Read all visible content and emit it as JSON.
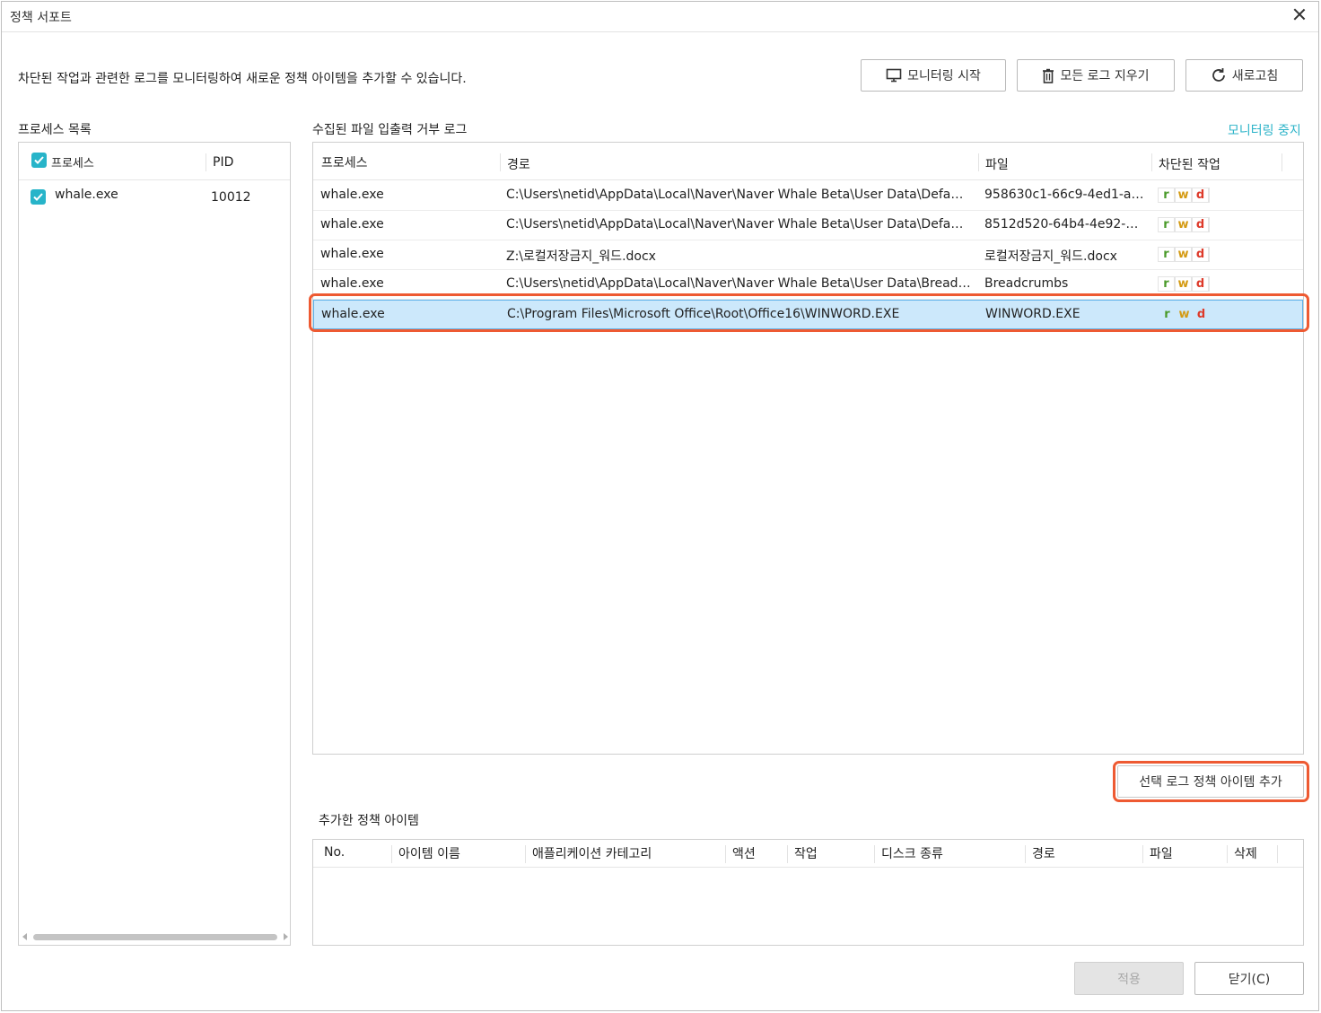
{
  "window": {
    "title": "정책 서포트"
  },
  "description": "차단된 작업과 관련한 로그를 모니터링하여 새로운 정책 아이템을 추가할 수 있습니다.",
  "toolbar": {
    "monitor_start": "모니터링 시작",
    "clear_logs": "모든 로그 지우기",
    "refresh": "새로고침"
  },
  "process_list": {
    "label": "프로세스 목록",
    "columns": {
      "process": "프로세스",
      "pid": "PID"
    },
    "rows": [
      {
        "name": "whale.exe",
        "pid": "10012"
      }
    ]
  },
  "log": {
    "label": "수집된 파일 입출력 거부 로그",
    "stop_link": "모니터링 중지",
    "columns": {
      "process": "프로세스",
      "path": "경로",
      "file": "파일",
      "blocked": "차단된 작업"
    },
    "rows": [
      {
        "process": "whale.exe",
        "path": "C:\\Users\\netid\\AppData\\Local\\Naver\\Naver Whale Beta\\User Data\\Default\\...",
        "file": "958630c1-66c9-4ed1-a3...",
        "ops": [
          "r",
          "w",
          "d"
        ]
      },
      {
        "process": "whale.exe",
        "path": "C:\\Users\\netid\\AppData\\Local\\Naver\\Naver Whale Beta\\User Data\\Default\\...",
        "file": "8512d520-64b4-4e92-97...",
        "ops": [
          "r",
          "w",
          "d"
        ]
      },
      {
        "process": "whale.exe",
        "path": "Z:\\로컬저장금지_워드.docx",
        "file": "로컬저장금지_워드.docx",
        "ops": [
          "r",
          "w",
          "d"
        ]
      },
      {
        "process": "whale.exe",
        "path": "C:\\Users\\netid\\AppData\\Local\\Naver\\Naver Whale Beta\\User Data\\Breadcr...",
        "file": "Breadcrumbs",
        "ops": [
          "r",
          "w",
          "d"
        ]
      },
      {
        "process": "whale.exe",
        "path": "C:\\Program Files\\Microsoft Office\\Root\\Office16\\WINWORD.EXE",
        "file": "WINWORD.EXE",
        "ops": [
          "r",
          "w",
          "d"
        ]
      }
    ]
  },
  "add_selected_button": "선택 로그 정책 아이템 추가",
  "policy_items": {
    "label": "추가한 정책 아이템",
    "columns": {
      "no": "No.",
      "name": "아이템 이름",
      "category": "애플리케이션 카테고리",
      "action": "액션",
      "task": "작업",
      "disk": "디스크 종류",
      "path": "경로",
      "file": "파일",
      "delete": "삭제"
    }
  },
  "footer": {
    "apply": "적용",
    "close": "닫기(C)"
  },
  "colors": {
    "accent": "#27b4c9",
    "highlight": "#ee5a32",
    "selection": "#cce8fb"
  }
}
